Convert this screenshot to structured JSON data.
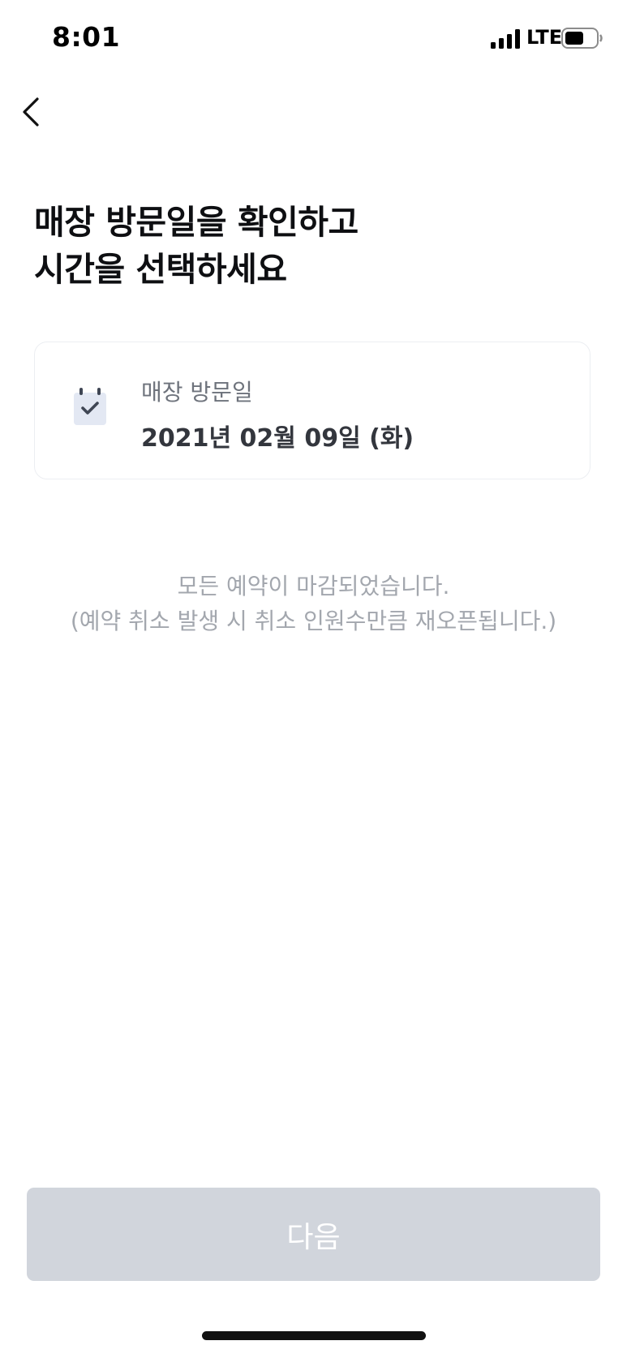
{
  "status_bar": {
    "time": "8:01",
    "network": "LTE",
    "icons": [
      "signal-icon",
      "battery-icon"
    ]
  },
  "header": {
    "back_icon": "chevron-left-icon"
  },
  "title": {
    "line1": "매장 방문일을 확인하고",
    "line2": "시간을 선택하세요"
  },
  "visit_card": {
    "icon": "calendar-check-icon",
    "label": "매장 방문일",
    "date": "2021년 02월 09일 (화)"
  },
  "notice": {
    "line1": "모든 예약이 마감되었습니다.",
    "line2": "(예약 취소 발생 시 취소 인원수만큼 재오픈됩니다.)"
  },
  "footer": {
    "next_label": "다음",
    "next_enabled": false
  },
  "colors": {
    "title": "#0e0f12",
    "card_border": "#eceef2",
    "notice_text": "#a3a7ae",
    "button_disabled_bg": "#d1d5dc",
    "calendar_fill": "#e3e8f3",
    "calendar_check": "#3f4654"
  }
}
